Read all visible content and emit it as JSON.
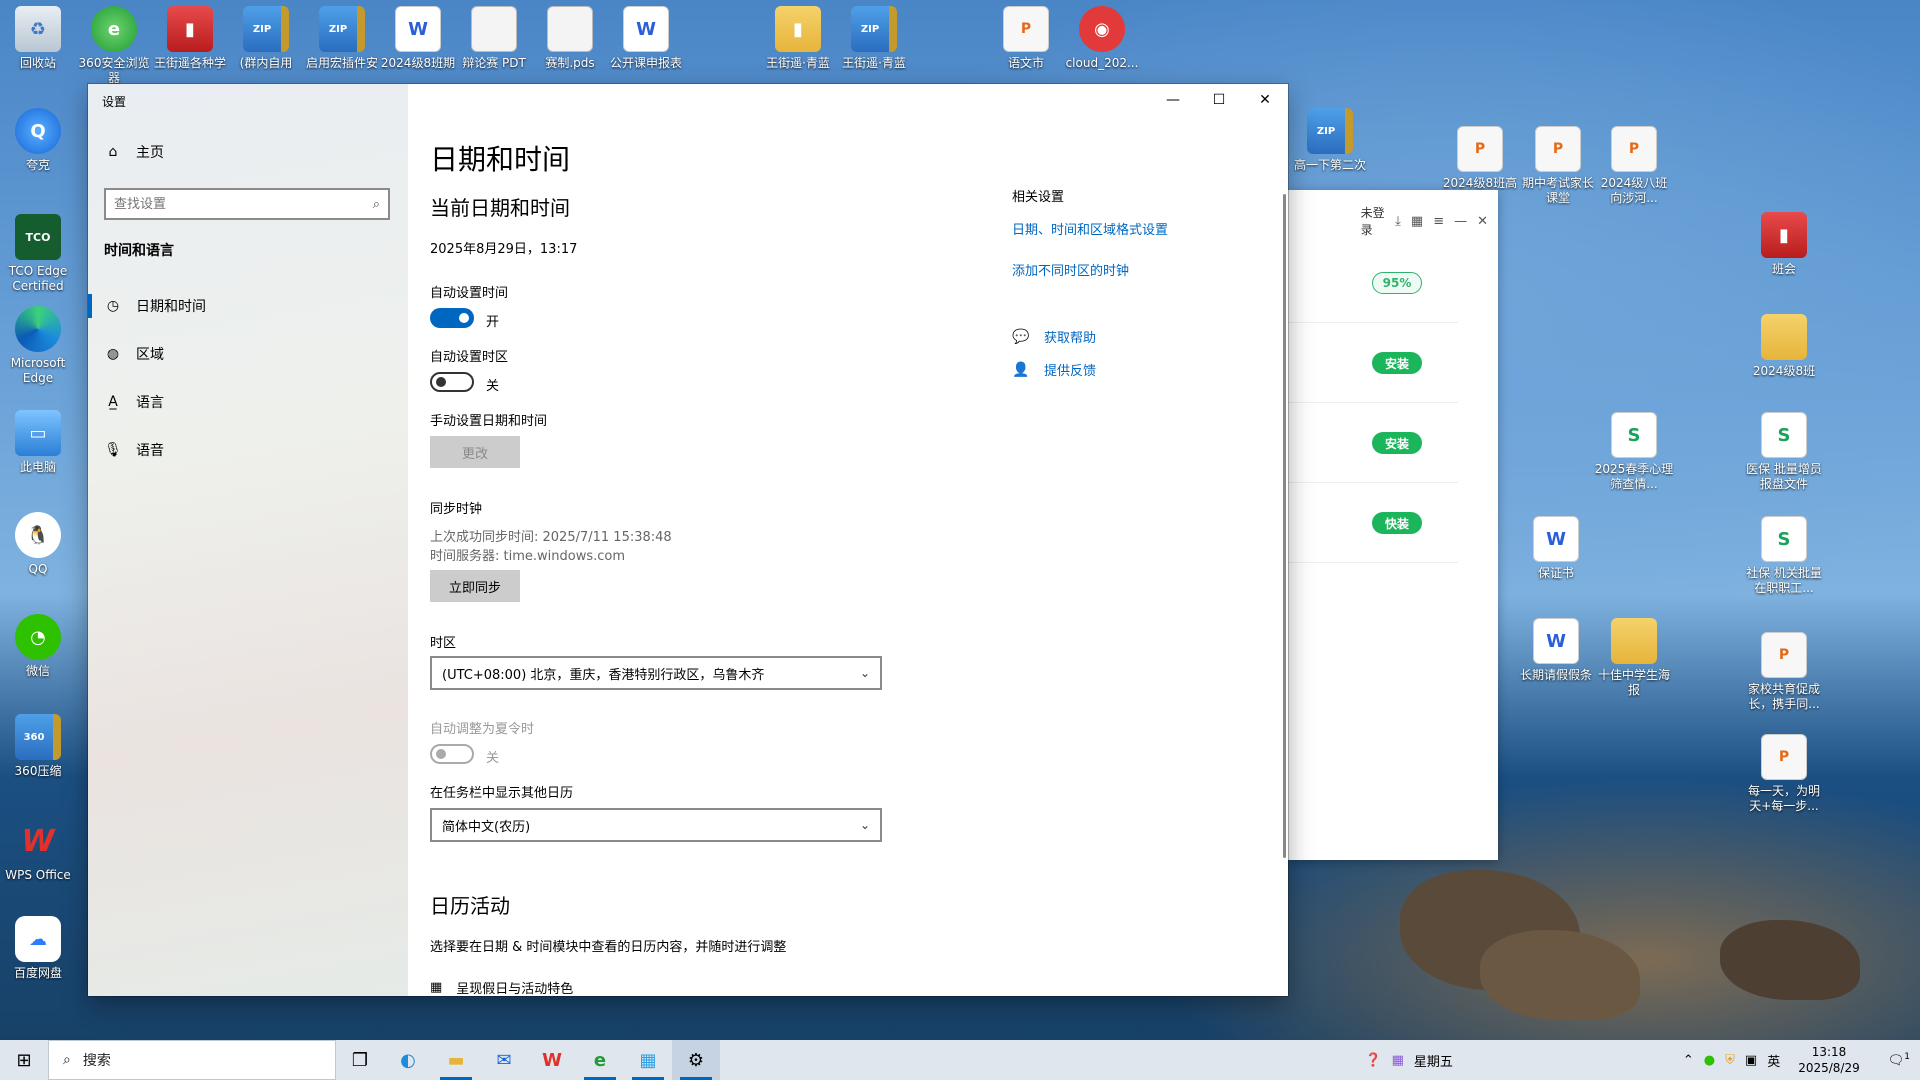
{
  "window": {
    "title": "设置",
    "min": "—",
    "max": "☐",
    "close": "✕"
  },
  "sidebar": {
    "home": "主页",
    "search_placeholder": "查找设置",
    "section": "时间和语言",
    "items": [
      {
        "label": "日期和时间",
        "icon": "clock-icon",
        "glyph": "◷"
      },
      {
        "label": "区域",
        "icon": "globe-icon",
        "glyph": "◍"
      },
      {
        "label": "语言",
        "icon": "language-icon",
        "glyph": "A̲"
      },
      {
        "label": "语音",
        "icon": "microphone-icon",
        "glyph": "🎙"
      }
    ]
  },
  "main": {
    "title": "日期和时间",
    "current_heading": "当前日期和时间",
    "current_datetime": "2025年8月29日，13:17",
    "auto_time_label": "自动设置时间",
    "auto_time_state": "开",
    "auto_tz_label": "自动设置时区",
    "auto_tz_state": "关",
    "manual_label": "手动设置日期和时间",
    "change_button": "更改",
    "sync_label": "同步时钟",
    "last_sync": "上次成功同步时间: 2025/7/11 15:38:48",
    "time_server": "时间服务器: time.windows.com",
    "sync_button": "立即同步",
    "timezone_label": "时区",
    "timezone_value": "(UTC+08:00) 北京，重庆，香港特别行政区，乌鲁木齐",
    "dst_label": "自动调整为夏令时",
    "dst_state": "关",
    "calendar_label": "在任务栏中显示其他日历",
    "calendar_value": "简体中文(农历)",
    "calendar_heading": "日历活动",
    "calendar_desc": "选择要在日期 & 时间模块中查看的日历内容，并随时进行调整",
    "holiday_label": "呈现假日与活动特色"
  },
  "related": {
    "title": "相关设置",
    "link1": "日期、时间和区域格式设置",
    "link2": "添加不同时区的时钟",
    "help": "获取帮助",
    "feedback": "提供反馈"
  },
  "popup": {
    "login": "未登录",
    "pills": [
      "95%",
      "安装",
      "安装",
      "快装"
    ]
  },
  "desktop": {
    "left": [
      {
        "label": "回收站",
        "icon": "recycle-bin-icon",
        "cls": "recycle",
        "glyph": "♻"
      },
      {
        "label": "夸克",
        "icon": "quark-icon",
        "cls": "blue",
        "glyph": "Q"
      },
      {
        "label": "TCO Edge Certified",
        "icon": "tco-icon",
        "cls": "tco",
        "glyph": "TCO"
      },
      {
        "label": "Microsoft Edge",
        "icon": "edge-icon",
        "cls": "edge",
        "glyph": ""
      },
      {
        "label": "此电脑",
        "icon": "computer-icon",
        "cls": "pc",
        "glyph": "▭"
      },
      {
        "label": "QQ",
        "icon": "qq-icon",
        "cls": "qq",
        "glyph": "🐧"
      },
      {
        "label": "微信",
        "icon": "wechat-icon",
        "cls": "wechat",
        "glyph": "◔"
      },
      {
        "label": "360压缩",
        "icon": "zip-icon",
        "cls": "zip",
        "glyph": "360"
      },
      {
        "label": "WPS Office",
        "icon": "wps-icon",
        "cls": "wps",
        "glyph": "W"
      },
      {
        "label": "百度网盘",
        "icon": "baidu-netdisk-icon",
        "cls": "baidu",
        "glyph": "☁"
      }
    ],
    "top": [
      {
        "label": "360安全浏览器",
        "icon": "360-browser-icon",
        "cls": "green",
        "glyph": "e"
      },
      {
        "label": "王街遥各种学",
        "icon": "book-icon",
        "cls": "redfolder",
        "glyph": "▮"
      },
      {
        "label": "(群内自用",
        "icon": "zip-icon",
        "cls": "zip",
        "glyph": "ZIP"
      },
      {
        "label": "启用宏插件安",
        "icon": "zip-icon",
        "cls": "zip",
        "glyph": "ZIP"
      },
      {
        "label": "2024级8班期",
        "icon": "word-doc-icon",
        "cls": "word",
        "glyph": "W"
      },
      {
        "label": "辩论赛 PDT",
        "icon": "file-icon",
        "cls": "doc",
        "glyph": ""
      },
      {
        "label": "赛制.pds",
        "icon": "file-icon",
        "cls": "doc",
        "glyph": ""
      },
      {
        "label": "公开课申报表",
        "icon": "word-doc-icon",
        "cls": "word",
        "glyph": "W"
      },
      {
        "label": "王街遥·青蓝",
        "icon": "book-icon",
        "cls": "folder",
        "glyph": "▮"
      },
      {
        "label": "王街遥·青蓝",
        "icon": "zip-icon",
        "cls": "zip",
        "glyph": "ZIP"
      },
      {
        "label": "语文市",
        "icon": "ppt-icon",
        "cls": "ppt",
        "glyph": "P"
      },
      {
        "label": "cloud_202...",
        "icon": "netease-music-icon",
        "cls": "net",
        "glyph": "◉"
      }
    ],
    "right": [
      {
        "label": "高一下第二次",
        "icon": "zip-icon",
        "cls": "zip",
        "glyph": "ZIP"
      },
      {
        "label": "2024级8班高",
        "icon": "ppt-icon",
        "cls": "ppt",
        "glyph": "P"
      },
      {
        "label": "期中考试家长课堂",
        "icon": "ppt-icon",
        "cls": "ppt",
        "glyph": "P"
      },
      {
        "label": "2024级八班 向涉河...",
        "icon": "ppt-icon",
        "cls": "ppt",
        "glyph": "P"
      },
      {
        "label": "班会",
        "icon": "book-icon",
        "cls": "redfolder",
        "glyph": "▮"
      },
      {
        "label": "2024级8班",
        "icon": "folder-icon",
        "cls": "folder",
        "glyph": ""
      },
      {
        "label": "2025春季心理筛查情...",
        "icon": "sheet-icon",
        "cls": "sheet",
        "glyph": "S"
      },
      {
        "label": "医保 批量增员报盘文件",
        "icon": "sheet-icon",
        "cls": "sheet",
        "glyph": "S"
      },
      {
        "label": "保证书",
        "icon": "word-doc-icon",
        "cls": "word",
        "glyph": "W"
      },
      {
        "label": "社保 机关批量在职职工...",
        "icon": "sheet-icon",
        "cls": "sheet",
        "glyph": "S"
      },
      {
        "label": "长期请假假条",
        "icon": "word-doc-icon",
        "cls": "word",
        "glyph": "W"
      },
      {
        "label": "十佳中学生海报",
        "icon": "image-icon",
        "cls": "folder",
        "glyph": ""
      },
      {
        "label": "家校共育促成长，携手同...",
        "icon": "ppt-icon",
        "cls": "ppt",
        "glyph": "P"
      },
      {
        "label": "每一天，为明天+每一步...",
        "icon": "ppt-icon",
        "cls": "ppt",
        "glyph": "P"
      }
    ]
  },
  "taskbar": {
    "search": "搜索",
    "weekday": "星期五",
    "ime": "英",
    "time": "13:18",
    "date": "2025/8/29",
    "notif_count": "1"
  }
}
